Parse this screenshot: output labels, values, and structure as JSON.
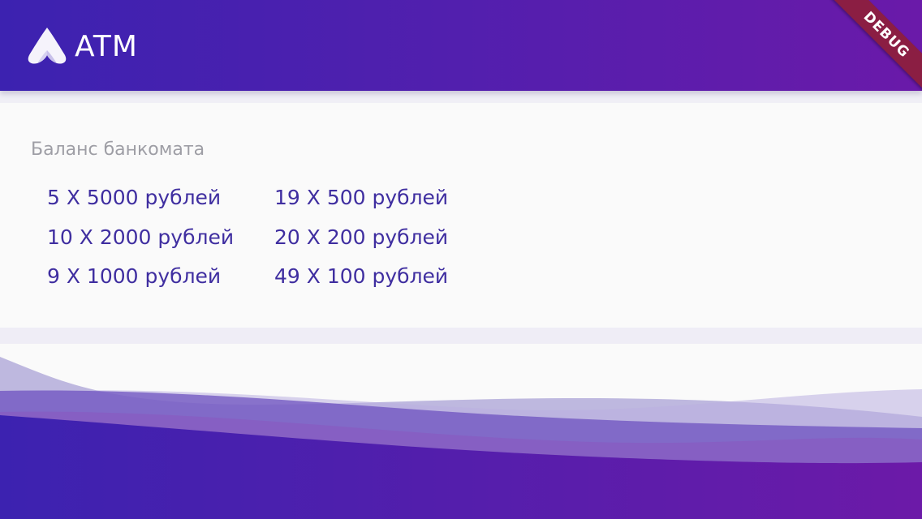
{
  "header": {
    "title": "ATM",
    "logo_icon": "atm-logo-icon",
    "debug_label": "DEBUG"
  },
  "balance": {
    "title": "Баланс банкомата",
    "items": [
      {
        "label": "5 X 5000 рублей"
      },
      {
        "label": "10 X 2000 рублей"
      },
      {
        "label": "9 X 1000 рублей"
      },
      {
        "label": "19 X 500 рублей"
      },
      {
        "label": "20 X 200 рублей"
      },
      {
        "label": "49 X 100 рублей"
      }
    ]
  },
  "colors": {
    "header_gradient_start": "#3c22b0",
    "header_gradient_end": "#6a1aa9",
    "accent_text": "#3f2ea0",
    "muted_text": "#9e9ea5",
    "debug_ribbon": "#8b1e43"
  }
}
